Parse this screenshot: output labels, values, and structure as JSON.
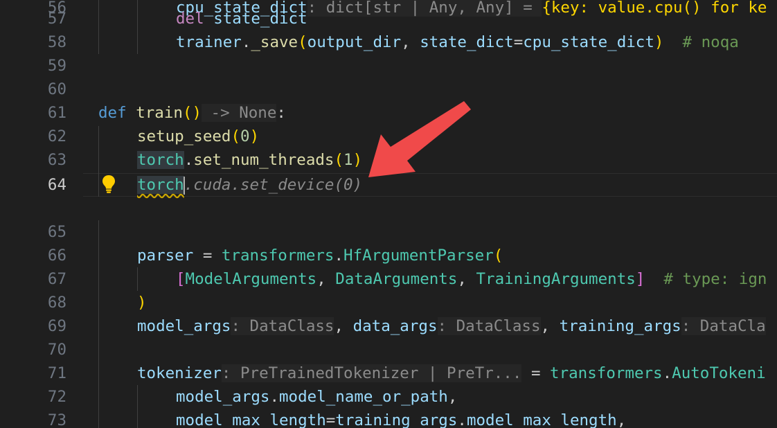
{
  "editor": {
    "theme_colors": {
      "background": "#1f1f1f",
      "keyword": "#569cd6",
      "function": "#dcdcaa",
      "variable": "#9cdcfe",
      "class": "#4ec9b0",
      "comment": "#6a9955",
      "arrow": "#f04a4a"
    },
    "line_numbers": [
      "56",
      "57",
      "58",
      "59",
      "60",
      "61",
      "62",
      "63",
      "64",
      "",
      "65",
      "66",
      "67",
      "68",
      "69",
      "70",
      "71",
      "72",
      "73"
    ],
    "active_line": "64",
    "lines": {
      "l56": {
        "a": "cpu_state_dict",
        "b": ": dict[str | Any, Any] = ",
        "c": "{key: value.cpu() for ke"
      },
      "l57": {
        "kw": "del",
        "var": "state_dict"
      },
      "l58": {
        "obj": "trainer",
        "dot": ".",
        "fn": "_save",
        "open": "(",
        "arg1": "output_dir",
        "sep": ", ",
        "arg2": "state_dict",
        "eq": "=",
        "arg3": "cpu_state_dict",
        "close": ")",
        "comment": "  # noqa"
      },
      "l61": {
        "kw": "def",
        "fn": "train",
        "parens": "()",
        "hint": " -> None",
        "colon": ":"
      },
      "l62": {
        "fn": "setup_seed",
        "open": "(",
        "num": "0",
        "close": ")"
      },
      "l63": {
        "obj": "torch",
        "dot": ".",
        "fn": "set_num_threads",
        "open": "(",
        "num": "1",
        "close": ")"
      },
      "l64": {
        "obj": "torch",
        "ghost": ".cuda.set_device(0)"
      },
      "l66": {
        "var": "parser",
        "eq": " = ",
        "mod": "transformers",
        "dot": ".",
        "cls": "HfArgumentParser",
        "open": "("
      },
      "l67": {
        "open": "[",
        "c1": "ModelArguments",
        "c2": "DataArguments",
        "c3": "TrainingArguments",
        "sep": ", ",
        "close": "]",
        "comment": "  # type: ign"
      },
      "l68": {
        "close": ")"
      },
      "l69": {
        "v1": "model_args",
        "h1": ": DataClass",
        "v2": "data_args",
        "h2": ": DataClass",
        "v3": "training_args",
        "h3": ": DataCla",
        "sep": ", "
      },
      "l71": {
        "var": "tokenizer",
        "hint": ": PreTrainedTokenizer | PreTr...",
        "eq": " = ",
        "mod": "transformers",
        "dot": ".",
        "cls": "AutoTokeni"
      },
      "l72": {
        "obj": "model_args",
        "dot": ".",
        "attr": "model_name_or_path",
        "comma": ","
      },
      "l73": {
        "kw": "model_max_length",
        "eq": "=",
        "obj": "training_args",
        "dot": ".",
        "attr": "model_max_length",
        "comma": ","
      }
    },
    "icons": {
      "lightbulb": "lightbulb-icon",
      "annotation_arrow": "red-arrow-annotation"
    }
  }
}
